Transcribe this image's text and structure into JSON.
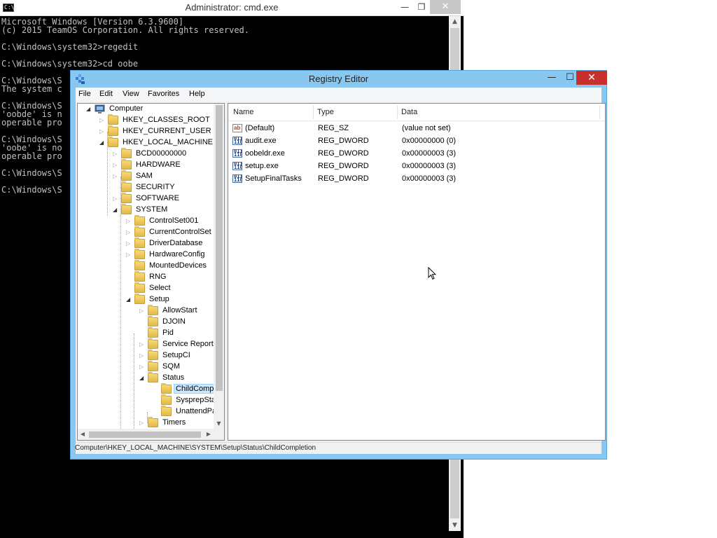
{
  "cmd": {
    "title": "Administrator: cmd.exe",
    "icon_text": "C:\\",
    "controls": {
      "minimize": "—",
      "maximize": "❐",
      "close": "✕"
    },
    "lines": [
      {
        "row": 0,
        "text": "Microsoft Windows [Version 6.3.9600]"
      },
      {
        "row": 1,
        "text": "(c) 2015 TeamOS Corporation. All rights reserved."
      },
      {
        "row": 3,
        "text": "C:\\Windows\\system32>regedit"
      },
      {
        "row": 5,
        "text": "C:\\Windows\\system32>cd oobe"
      },
      {
        "row": 7,
        "text": "C:\\Windows\\S"
      },
      {
        "row": 8,
        "text": "The system c"
      },
      {
        "row": 10,
        "text": "C:\\Windows\\S"
      },
      {
        "row": 11,
        "text": "'oobde' is n"
      },
      {
        "row": 12,
        "text": "operable pro"
      },
      {
        "row": 14,
        "text": "C:\\Windows\\S"
      },
      {
        "row": 15,
        "text": "'oobe' is no"
      },
      {
        "row": 16,
        "text": "operable pro"
      },
      {
        "row": 18,
        "text": "C:\\Windows\\S"
      },
      {
        "row": 20,
        "text": "C:\\Windows\\S"
      }
    ]
  },
  "regedit": {
    "title": "Registry Editor",
    "controls": {
      "minimize": "—",
      "maximize": "☐",
      "close": "✕"
    },
    "menu": [
      "File",
      "Edit",
      "View",
      "Favorites",
      "Help"
    ],
    "tree": [
      {
        "label": "Computer",
        "level": 0,
        "expander": "open",
        "icon": "computer"
      },
      {
        "label": "HKEY_CLASSES_ROOT",
        "level": 1,
        "expander": "closed"
      },
      {
        "label": "HKEY_CURRENT_USER",
        "level": 1,
        "expander": "closed"
      },
      {
        "label": "HKEY_LOCAL_MACHINE",
        "level": 1,
        "expander": "open"
      },
      {
        "label": "BCD00000000",
        "level": 2,
        "expander": "closed"
      },
      {
        "label": "HARDWARE",
        "level": 2,
        "expander": "closed"
      },
      {
        "label": "SAM",
        "level": 2,
        "expander": "closed"
      },
      {
        "label": "SECURITY",
        "level": 2,
        "expander": "none"
      },
      {
        "label": "SOFTWARE",
        "level": 2,
        "expander": "closed"
      },
      {
        "label": "SYSTEM",
        "level": 2,
        "expander": "open"
      },
      {
        "label": "ControlSet001",
        "level": 3,
        "expander": "closed"
      },
      {
        "label": "CurrentControlSet",
        "level": 3,
        "expander": "closed"
      },
      {
        "label": "DriverDatabase",
        "level": 3,
        "expander": "closed"
      },
      {
        "label": "HardwareConfig",
        "level": 3,
        "expander": "closed"
      },
      {
        "label": "MountedDevices",
        "level": 3,
        "expander": "none"
      },
      {
        "label": "RNG",
        "level": 3,
        "expander": "none"
      },
      {
        "label": "Select",
        "level": 3,
        "expander": "none"
      },
      {
        "label": "Setup",
        "level": 3,
        "expander": "open"
      },
      {
        "label": "AllowStart",
        "level": 4,
        "expander": "closed"
      },
      {
        "label": "DJOIN",
        "level": 4,
        "expander": "none"
      },
      {
        "label": "Pid",
        "level": 4,
        "expander": "none"
      },
      {
        "label": "Service Report",
        "level": 4,
        "expander": "closed"
      },
      {
        "label": "SetupCI",
        "level": 4,
        "expander": "closed"
      },
      {
        "label": "SQM",
        "level": 4,
        "expander": "closed"
      },
      {
        "label": "Status",
        "level": 4,
        "expander": "open"
      },
      {
        "label": "ChildComp",
        "level": 5,
        "expander": "none",
        "selected": true
      },
      {
        "label": "SysprepSta",
        "level": 5,
        "expander": "none"
      },
      {
        "label": "UnattendPa",
        "level": 5,
        "expander": "none"
      },
      {
        "label": "Timers",
        "level": 4,
        "expander": "closed"
      }
    ],
    "list_columns": {
      "name": "Name",
      "type": "Type",
      "data": "Data"
    },
    "values": [
      {
        "name": "(Default)",
        "type": "REG_SZ",
        "data": "(value not set)",
        "icon": "string"
      },
      {
        "name": "audit.exe",
        "type": "REG_DWORD",
        "data": "0x00000000 (0)",
        "icon": "binary"
      },
      {
        "name": "oobeldr.exe",
        "type": "REG_DWORD",
        "data": "0x00000003 (3)",
        "icon": "binary"
      },
      {
        "name": "setup.exe",
        "type": "REG_DWORD",
        "data": "0x00000003 (3)",
        "icon": "binary"
      },
      {
        "name": "SetupFinalTasks",
        "type": "REG_DWORD",
        "data": "0x00000003 (3)",
        "icon": "binary"
      }
    ],
    "value_icon_text": {
      "string": "ab",
      "binary": "011 110"
    },
    "status": "Computer\\HKEY_LOCAL_MACHINE\\SYSTEM\\Setup\\Status\\ChildCompletion"
  },
  "colors": {
    "regedit_frame": "#88c7ef",
    "close_button": "#c7302c",
    "selection": "#cce8ff",
    "console_text": "#c0c0c0"
  }
}
